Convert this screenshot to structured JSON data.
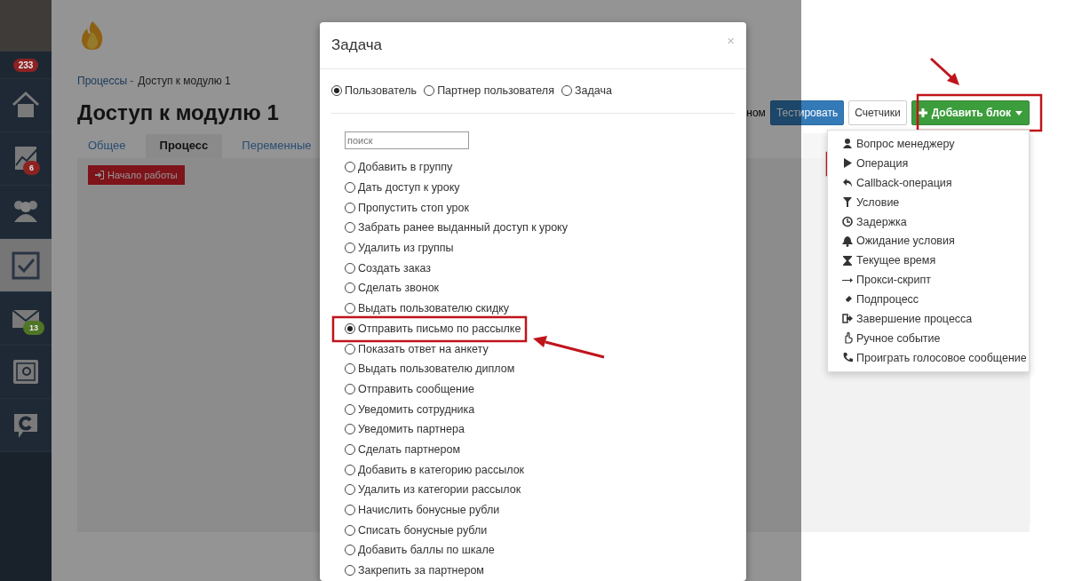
{
  "sidebar": {
    "badge": "233",
    "items": [
      {
        "selected": false
      },
      {
        "selected": false,
        "badge": "6",
        "color": "#8c2222"
      },
      {
        "selected": false
      },
      {
        "selected": true
      },
      {
        "selected": false,
        "badge": "13",
        "color": "#4f7526"
      },
      {
        "selected": false
      },
      {
        "selected": false
      }
    ]
  },
  "page": {
    "breadcrumb": {
      "link": "Процессы -",
      "current": "Доступ к модулю 1"
    },
    "title": "Доступ к модулю 1",
    "tabs": [
      {
        "label": "Общее",
        "selected": false
      },
      {
        "label": "Процесс",
        "selected": true
      },
      {
        "label": "Переменные",
        "selected": false
      }
    ],
    "start_block": "Начало работы",
    "toolbar": {
      "partial_text": "ном",
      "buttons": [
        {
          "label": "Тестировать",
          "kind": "primary"
        },
        {
          "label": "Счетчики",
          "kind": "default"
        },
        {
          "label": "Добавить блок",
          "kind": "success"
        }
      ]
    },
    "dropdown": {
      "items": [
        {
          "label": "Вопрос менеджеру"
        },
        {
          "label": "Операция"
        },
        {
          "label": "Callback-операция"
        },
        {
          "label": "Условие"
        },
        {
          "label": "Задержка"
        },
        {
          "label": "Ожидание условия"
        },
        {
          "label": "Текущее время"
        },
        {
          "label": "Прокси-скрипт"
        },
        {
          "label": "Подпроцесс"
        },
        {
          "label": "Завершение процесса"
        },
        {
          "label": "Ручное событие"
        },
        {
          "label": "Проиграть голосовое сообщение"
        }
      ]
    }
  },
  "modal": {
    "title": "Задача",
    "close": "×",
    "targets": [
      {
        "label": "Пользователь",
        "selected": true
      },
      {
        "label": "Партнер пользователя",
        "selected": false
      },
      {
        "label": "Задача",
        "selected": false
      }
    ],
    "search": {
      "placeholder": "поиск"
    },
    "actions": [
      {
        "label": "Добавить в группу",
        "selected": false
      },
      {
        "label": "Дать доступ к уроку",
        "selected": false
      },
      {
        "label": "Пропустить стоп урок",
        "selected": false
      },
      {
        "label": "Забрать ранее выданный доступ к уроку",
        "selected": false
      },
      {
        "label": "Удалить из группы",
        "selected": false
      },
      {
        "label": "Создать заказ",
        "selected": false
      },
      {
        "label": "Сделать звонок",
        "selected": false
      },
      {
        "label": "Выдать пользователю скидку",
        "selected": false
      },
      {
        "label": "Отправить письмо по рассылке",
        "selected": true
      },
      {
        "label": "Показать ответ на анкету",
        "selected": false
      },
      {
        "label": "Выдать пользователю диплом",
        "selected": false
      },
      {
        "label": "Отправить сообщение",
        "selected": false
      },
      {
        "label": "Уведомить сотрудника",
        "selected": false
      },
      {
        "label": "Уведомить партнера",
        "selected": false
      },
      {
        "label": "Сделать партнером",
        "selected": false
      },
      {
        "label": "Добавить в категорию рассылок",
        "selected": false
      },
      {
        "label": "Удалить из категории рассылок",
        "selected": false
      },
      {
        "label": "Начислить бонусные рубли",
        "selected": false
      },
      {
        "label": "Списать бонусные рубли",
        "selected": false
      },
      {
        "label": "Добавить баллы по шкале",
        "selected": false
      },
      {
        "label": "Закрепить за партнером",
        "selected": false
      }
    ]
  }
}
